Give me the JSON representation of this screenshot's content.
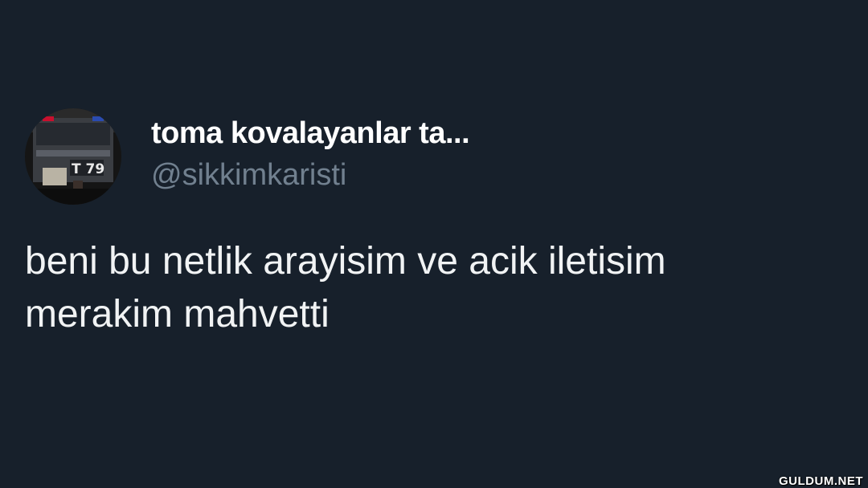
{
  "tweet": {
    "display_name": "toma kovalayanlar ta...",
    "handle": "@sikkimkaristi",
    "text_lines": [
      "beni bu netlik arayisim ve acik iletisim",
      "merakim mahvetti"
    ],
    "avatar": {
      "description_icon": "toma-truck-avatar-icon",
      "plate_text": "T 79"
    }
  },
  "watermark": "GULDUM.NET",
  "colors": {
    "background": "#17202b",
    "display_name": "#ffffff",
    "handle": "#71808f",
    "text": "#f1f3f4"
  }
}
